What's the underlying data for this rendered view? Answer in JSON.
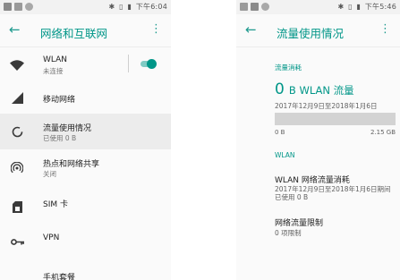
{
  "left": {
    "status": {
      "time": "下午6:04",
      "icons": [
        "notification-icon",
        "image-icon",
        "sync-icon",
        "bluetooth-icon",
        "vibrate-icon",
        "battery-icon"
      ]
    },
    "title": "网络和互联网",
    "items": [
      {
        "label": "WLAN",
        "sub": "未连接",
        "icon": "wifi-icon",
        "toggle": true
      },
      {
        "label": "移动网络",
        "sub": "",
        "icon": "cellular-icon"
      },
      {
        "label": "流量使用情况",
        "sub": "已使用 0 B",
        "icon": "data-usage-icon",
        "selected": true
      },
      {
        "label": "热点和网络共享",
        "sub": "关闭",
        "icon": "hotspot-icon"
      },
      {
        "label": "SIM 卡",
        "sub": "",
        "icon": "sim-card-icon"
      },
      {
        "label": "VPN",
        "sub": "",
        "icon": "vpn-key-icon"
      },
      {
        "label": "手机套餐",
        "sub": "",
        "icon": ""
      }
    ]
  },
  "right": {
    "status": {
      "time": "下午5:46",
      "icons": [
        "image-icon",
        "notification-icon",
        "sync-icon",
        "bluetooth-icon",
        "vibrate-icon",
        "battery-icon"
      ]
    },
    "title": "流量使用情况",
    "usage": {
      "section_label": "流量消耗",
      "amount": "0",
      "unit": "B WLAN 流量",
      "period": "2017年12月9日至2018年1月6日",
      "bar_min": "0 B",
      "bar_max": "2.15 GB",
      "fill_fraction": 0
    },
    "wlan_section": "WLAN",
    "wlan_usage": {
      "title": "WLAN 网络流量消耗",
      "line1": "2017年12月9日至2018年1月6日期间",
      "line2": "已使用 0 B"
    },
    "limit": {
      "title": "网络流量限制",
      "sub": "0 项限制"
    }
  },
  "colors": {
    "accent": "#009688",
    "accent_light": "#80cbc4",
    "selected_row": "#ececec",
    "bar": "#d3d3d3"
  }
}
